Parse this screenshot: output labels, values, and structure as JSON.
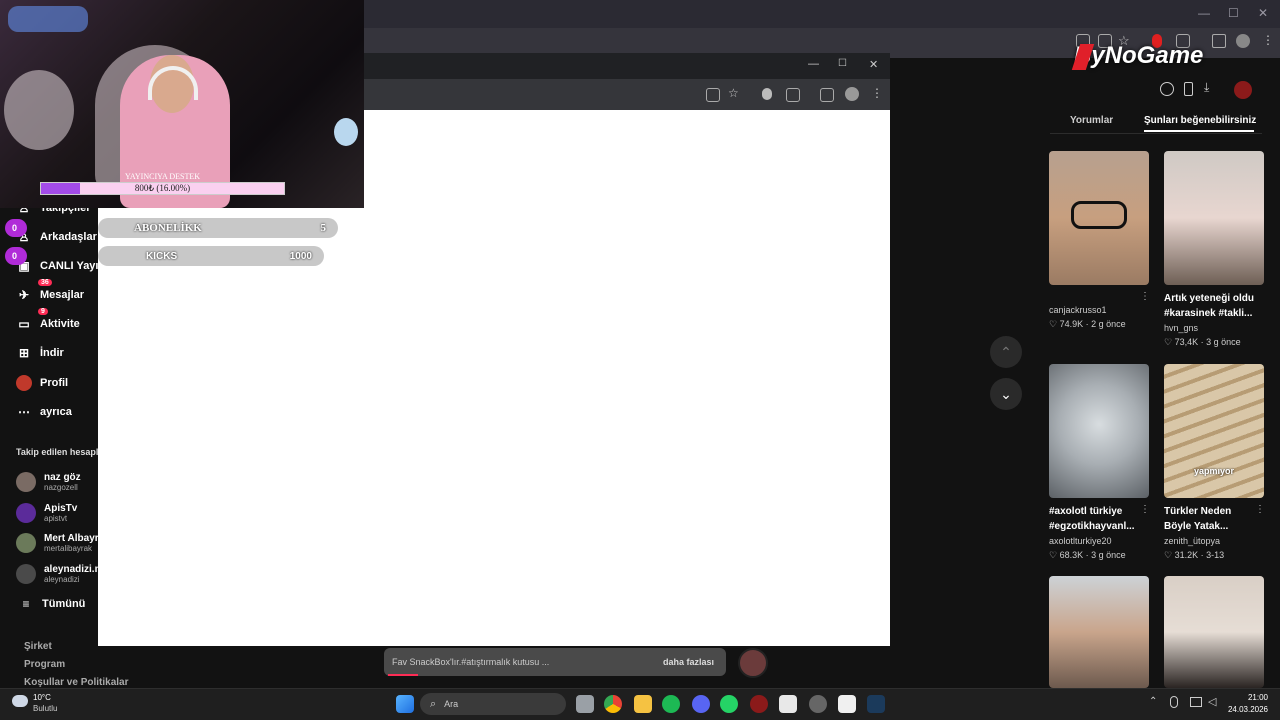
{
  "cam": {
    "support_label": "YAYINCIYA DESTEK",
    "support_bar_text": "800₺ (16.00%)",
    "support_progress": 0.16
  },
  "overlay": {
    "subs_label": "ABONELİKK",
    "subs_value": "5",
    "kicks_label": "KICKS",
    "kicks_value": "1000",
    "badge_top": "0",
    "badge_bottom": "0"
  },
  "sidebar": {
    "items": [
      {
        "label": "Takipçiler"
      },
      {
        "label": "Arkadaşlar"
      },
      {
        "label": "CANLI Yayın"
      },
      {
        "label": "Mesajlar",
        "badge": "36"
      },
      {
        "label": "Aktivite",
        "badge": "9"
      },
      {
        "label": "İndir"
      },
      {
        "label": "Profil"
      },
      {
        "label": "ayrıca"
      }
    ],
    "following_title": "Takip edilen hesaplar",
    "following": [
      {
        "name": "naz göz",
        "user": "nazgozell"
      },
      {
        "name": "ApisTv",
        "user": "apistvt"
      },
      {
        "name": "Mert Albayrak",
        "user": "mertalibayrak"
      },
      {
        "name": "aleynadizi.m",
        "user": "aleynadizi"
      }
    ],
    "see_all": "Tümünü",
    "footer": [
      "Şirket",
      "Program",
      "Koşullar ve Politikalar"
    ]
  },
  "right": {
    "logo": "ByNoGame",
    "tabs": [
      "Yorumlar",
      "Şunları beğenebilirsiniz"
    ],
    "videos": [
      {
        "title": "",
        "user": "canjackrusso1",
        "stats": "♡ 74.9K · 2 g önce"
      },
      {
        "title": "Artık yeteneği oldu #karasinek #takli...",
        "user": "hvn_gns",
        "stats": "♡ 73,4K · 3 g önce"
      },
      {
        "title": "#axolotl türkiye #egzotikhayvanl...",
        "user": "axolotlturkiye20",
        "stats": "♡ 68.3K · 3 g önce"
      },
      {
        "title": "Türkler Neden Böyle Yatak...",
        "user": "zenith_ütopya",
        "stats": "♡ 31.2K · 3-13"
      }
    ],
    "thumb_caption": "yapmıyor"
  },
  "snack": {
    "text": "Fav SnackBox'lır.#atıştırmalık kutusu ...",
    "more": "daha fazlası"
  },
  "taskbar": {
    "weather_temp": "10°C",
    "weather_desc": "Bulutlu",
    "search_placeholder": "Ara",
    "time": "21:00",
    "date": "24.03.2026"
  }
}
